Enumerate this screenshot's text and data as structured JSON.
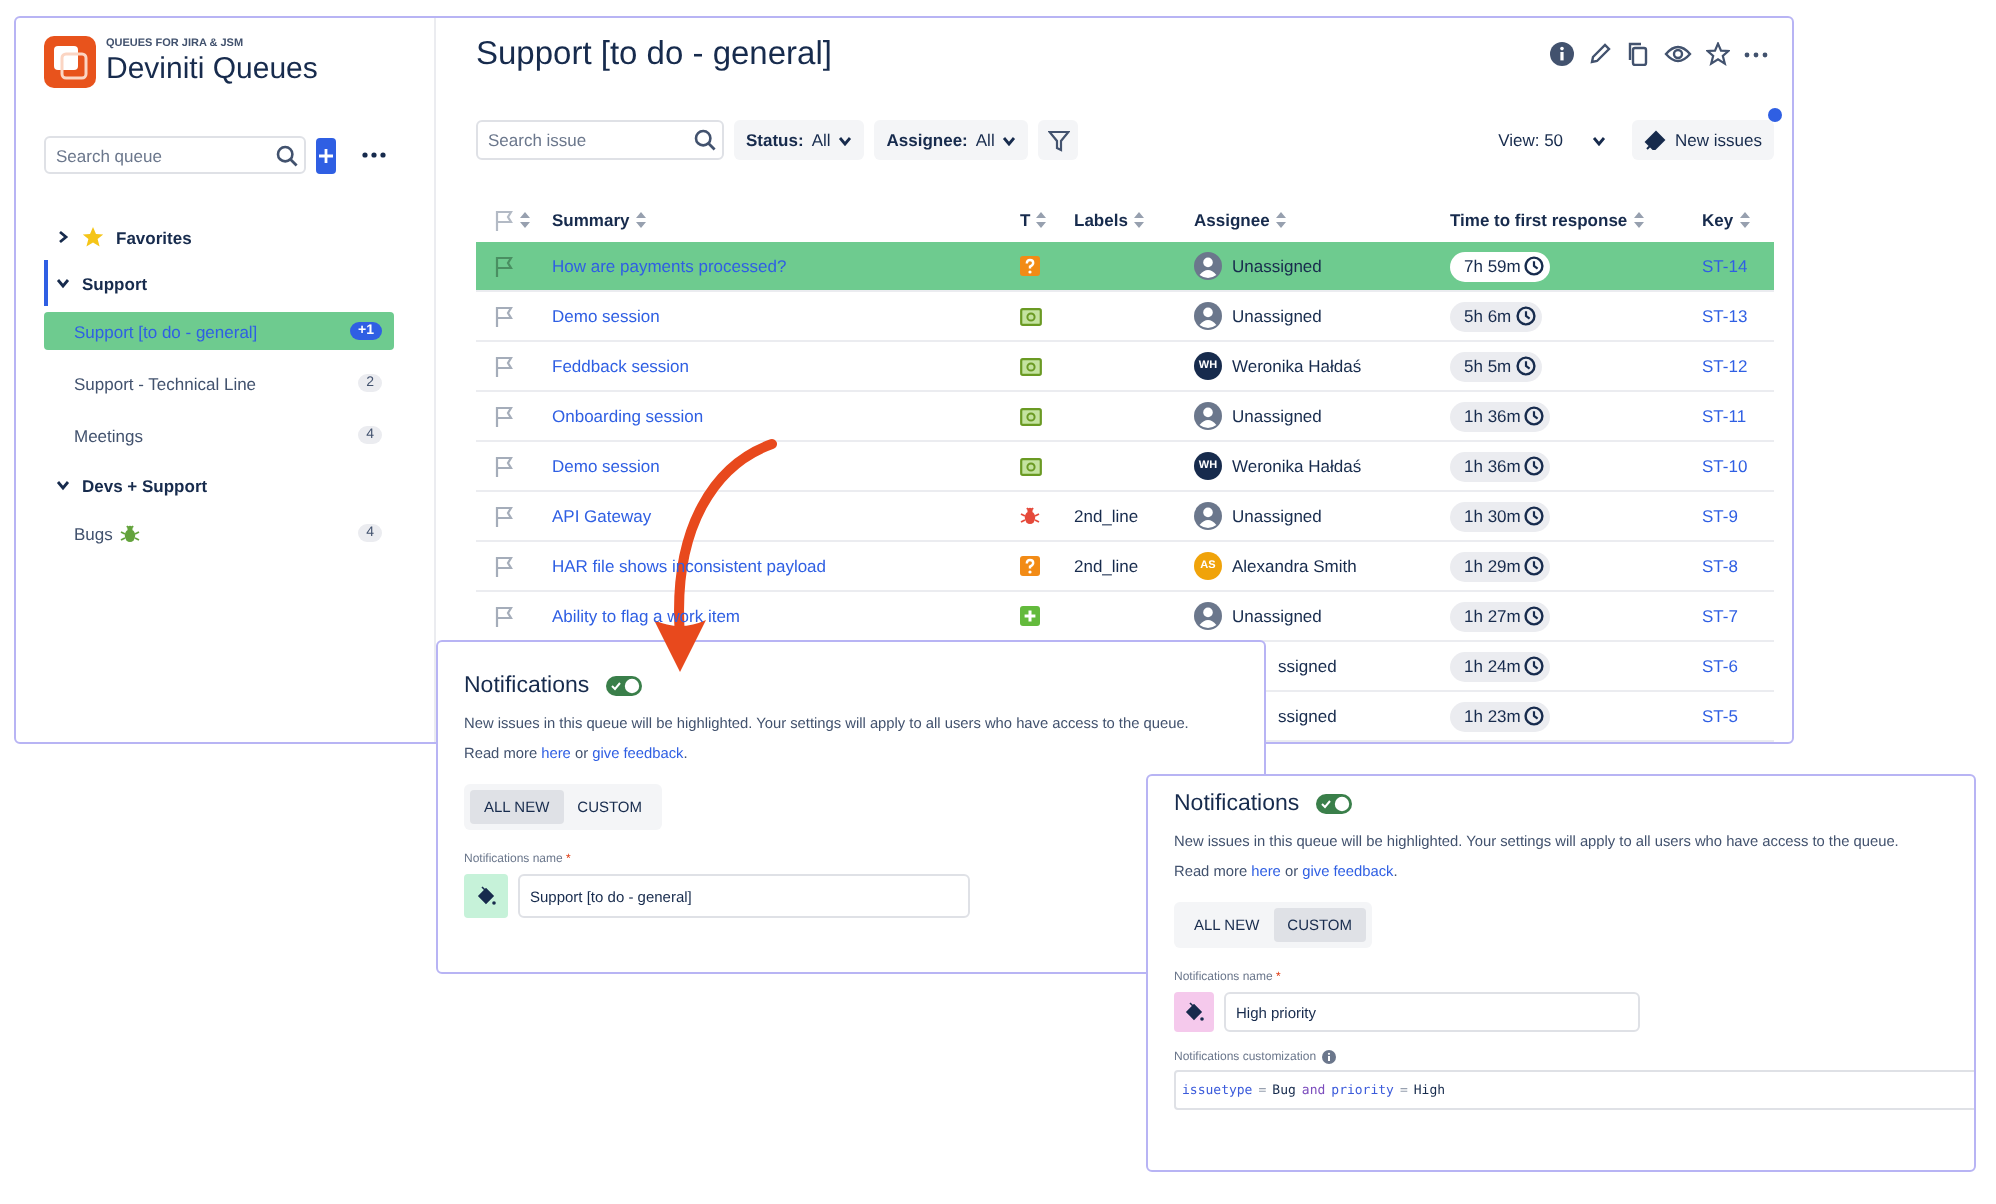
{
  "sidebar": {
    "brand_caption": "QUEUES FOR JIRA & JSM",
    "brand_name": "Deviniti Queues",
    "search": {
      "placeholder": "Search queue"
    },
    "groups": [
      {
        "label": "Favorites",
        "kind": "favorites",
        "expanded": false,
        "active": false
      },
      {
        "label": "Support",
        "expanded": true,
        "active": true,
        "items": [
          {
            "label": "Support [to do - general]",
            "count": "+1",
            "selected": true
          },
          {
            "label": "Support - Technical Line",
            "count": "2",
            "selected": false
          },
          {
            "label": "Meetings",
            "count": "4",
            "selected": false
          }
        ]
      },
      {
        "label": "Devs + Support",
        "expanded": true,
        "active": false,
        "items": [
          {
            "label": "Bugs",
            "kind": "bug",
            "count": "4",
            "selected": false
          }
        ]
      }
    ]
  },
  "main": {
    "title": "Support [to do - general]",
    "search": {
      "placeholder": "Search issue"
    },
    "filters": [
      {
        "name": "Status:",
        "value": "All"
      },
      {
        "name": "Assignee:",
        "value": "All"
      }
    ],
    "view": "View: 50",
    "new_issues": {
      "label": "New issues",
      "badge": true
    }
  },
  "table": {
    "columns": [
      "Summary",
      "T",
      "Labels",
      "Assignee",
      "Time to first response",
      "Key"
    ],
    "rows": [
      {
        "highlighted": true,
        "summary": "How are payments processed?",
        "kind": "question",
        "assignee": {
          "kind": "unassigned",
          "name": "Unassigned"
        },
        "time": "7h 59m",
        "key": "ST-14"
      },
      {
        "highlighted": false,
        "summary": "Demo session",
        "kind": "cash",
        "assignee": {
          "kind": "unassigned",
          "name": "Unassigned"
        },
        "time": "5h 6m",
        "key": "ST-13"
      },
      {
        "highlighted": false,
        "summary": "Feddback session",
        "kind": "cash",
        "assignee": {
          "kind": "initials",
          "initials": "WH",
          "color": "#172b4d",
          "name": "Weronika Hałdaś"
        },
        "time": "5h 5m",
        "key": "ST-12"
      },
      {
        "highlighted": false,
        "summary": "Onboarding session",
        "kind": "cash",
        "assignee": {
          "kind": "unassigned",
          "name": "Unassigned"
        },
        "time": "1h 36m",
        "key": "ST-11"
      },
      {
        "highlighted": false,
        "summary": "Demo session",
        "kind": "cash",
        "assignee": {
          "kind": "initials",
          "initials": "WH",
          "color": "#172b4d",
          "name": "Weronika Hałdaś"
        },
        "time": "1h 36m",
        "key": "ST-10"
      },
      {
        "highlighted": false,
        "summary": "API Gateway",
        "kind": "bug",
        "labels": "2nd_line",
        "assignee": {
          "kind": "unassigned",
          "name": "Unassigned"
        },
        "time": "1h 30m",
        "key": "ST-9"
      },
      {
        "highlighted": false,
        "summary": "HAR file shows inconsistent payload",
        "kind": "question",
        "labels": "2nd_line",
        "assignee": {
          "kind": "initials",
          "initials": "AS",
          "color": "#f0a30a",
          "name": "Alexandra Smith"
        },
        "time": "1h 29m",
        "key": "ST-8"
      },
      {
        "highlighted": false,
        "summary": "Ability to flag a work item",
        "kind": "plus",
        "assignee": {
          "kind": "unassigned",
          "name": "Unassigned"
        },
        "time": "1h 27m",
        "key": "ST-7"
      },
      {
        "highlighted": false,
        "assignee": {
          "kind": "covered",
          "name": "ssigned"
        },
        "time": "1h 24m",
        "key": "ST-6"
      },
      {
        "highlighted": false,
        "assignee": {
          "kind": "covered",
          "name": "ssigned"
        },
        "time": "1h 23m",
        "key": "ST-5"
      }
    ]
  },
  "notification_panels": [
    {
      "title": "Notifications",
      "enabled": true,
      "description": "New issues in this queue will be highlighted. Your settings will apply to all users who have access to the queue.",
      "read_more": "Read more",
      "link_here": "here",
      "or": "or",
      "link_feedback": "give feedback",
      "period": ".",
      "modes": [
        {
          "label": "ALL NEW",
          "selected": true
        },
        {
          "label": "CUSTOM",
          "selected": false
        }
      ],
      "name_label": "Notifications name",
      "required_mark": "*",
      "name_value": "Support [to do - general]",
      "color": "#c6f2d9"
    },
    {
      "title": "Notifications",
      "enabled": true,
      "description": "New issues in this queue will be highlighted. Your settings will apply to all users who have access to the queue.",
      "read_more": "Read more",
      "link_here": "here",
      "or": "or",
      "link_feedback": "give feedback",
      "period": ".",
      "modes": [
        {
          "label": "ALL NEW",
          "selected": false
        },
        {
          "label": "CUSTOM",
          "selected": true
        }
      ],
      "name_label": "Notifications name",
      "required_mark": "*",
      "name_value": "High priority",
      "color": "#f5c9ec",
      "customization": {
        "label": "Notifications customization",
        "query": [
          {
            "text": "issuetype",
            "kind": "field"
          },
          {
            "text": "=",
            "kind": "op"
          },
          {
            "text": "Bug",
            "kind": "value"
          },
          {
            "text": "and",
            "kind": "keyword"
          },
          {
            "text": "priority",
            "kind": "field"
          },
          {
            "text": "=",
            "kind": "op"
          },
          {
            "text": "High",
            "kind": "value"
          }
        ]
      }
    }
  ]
}
